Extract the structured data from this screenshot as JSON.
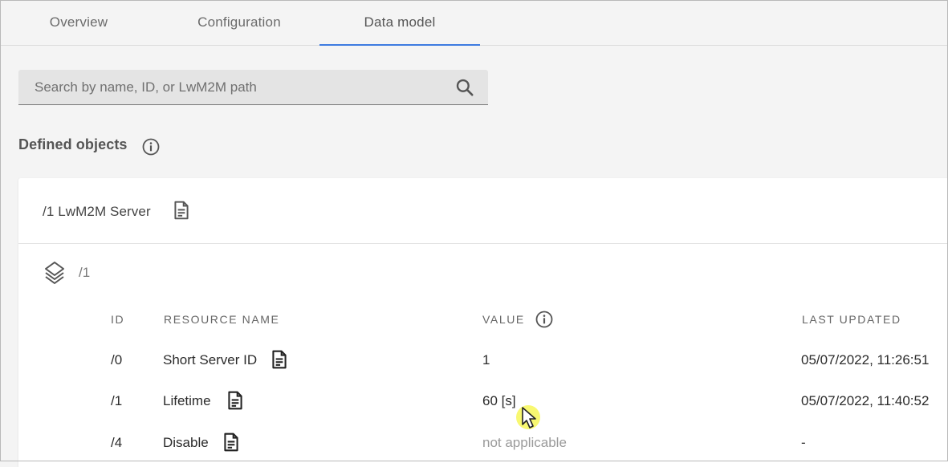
{
  "tabs": [
    {
      "label": "Overview"
    },
    {
      "label": "Configuration"
    },
    {
      "label": "Data model",
      "active": true
    }
  ],
  "search": {
    "placeholder": "Search by name, ID, or LwM2M path",
    "value": ""
  },
  "section": {
    "title": "Defined objects"
  },
  "object": {
    "title": "/1 LwM2M Server",
    "instance": "/1",
    "columns": {
      "id": "ID",
      "name": "RESOURCE NAME",
      "value": "VALUE",
      "updated": "LAST UPDATED"
    },
    "rows": [
      {
        "id": "/0",
        "name": "Short Server ID",
        "value": "1",
        "updated": "05/07/2022, 11:26:51"
      },
      {
        "id": "/1",
        "name": "Lifetime",
        "value": "60 [s]",
        "updated": "05/07/2022, 11:40:52"
      },
      {
        "id": "/4",
        "name": "Disable",
        "value": "not applicable",
        "updated": "-"
      }
    ]
  },
  "icons": {
    "search": "search-icon",
    "info": "info-icon",
    "document": "document-icon",
    "layers": "layers-icon",
    "cursor": "mouse-cursor"
  },
  "colors": {
    "accent": "#3d7be0",
    "background": "#f4f4f4",
    "card": "#ffffff",
    "cursor_highlight": "#f5f542"
  }
}
